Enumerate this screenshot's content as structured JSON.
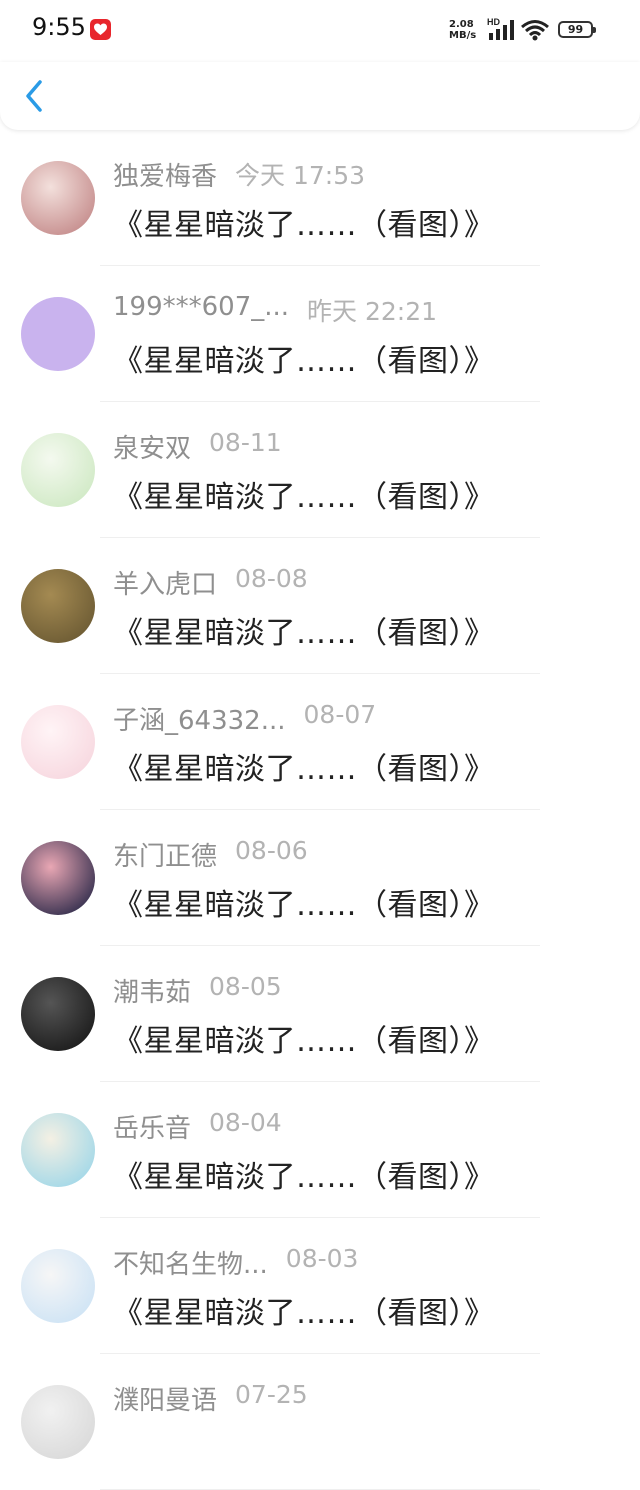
{
  "status_bar": {
    "time": "9:55",
    "net_speed_value": "2.08",
    "net_speed_unit": "MB/s",
    "network_type": "HD",
    "battery": "99"
  },
  "nav": {
    "back_icon": "chevron-left-icon",
    "accent_color": "#2a9be6"
  },
  "messages": [
    {
      "user": "独爱梅香",
      "time": "今天 17:53",
      "title": "《星星暗淡了……（看图）》",
      "avatar_colors": [
        "#c48a8a",
        "#f3e0dc"
      ]
    },
    {
      "user": "199***607_...",
      "time": "昨天 22:21",
      "title": "《星星暗淡了……（看图）》",
      "avatar_colors": [
        "#c9b3ee",
        "#c9b3ee"
      ]
    },
    {
      "user": "泉安双",
      "time": "08-11",
      "title": "《星星暗淡了……（看图）》",
      "avatar_colors": [
        "#cfe9c4",
        "#f4f9ef"
      ]
    },
    {
      "user": "羊入虎口",
      "time": "08-08",
      "title": "《星星暗淡了……（看图）》",
      "avatar_colors": [
        "#6b5a33",
        "#a48a52"
      ]
    },
    {
      "user": "子涵_64332...",
      "time": "08-07",
      "title": "《星星暗淡了……（看图）》",
      "avatar_colors": [
        "#f7d7df",
        "#fff4f6"
      ]
    },
    {
      "user": "东门正德",
      "time": "08-06",
      "title": "《星星暗淡了……（看图）》",
      "avatar_colors": [
        "#2d2a4a",
        "#e9a7b4"
      ]
    },
    {
      "user": "潮韦茹",
      "time": "08-05",
      "title": "《星星暗淡了……（看图）》",
      "avatar_colors": [
        "#1a1a1a",
        "#555555"
      ]
    },
    {
      "user": "岳乐音",
      "time": "08-04",
      "title": "《星星暗淡了……（看图）》",
      "avatar_colors": [
        "#9fd7e8",
        "#f4f0e4"
      ]
    },
    {
      "user": "不知名生物...",
      "time": "08-03",
      "title": "《星星暗淡了……（看图）》",
      "avatar_colors": [
        "#cde3f5",
        "#f6f6f6"
      ]
    },
    {
      "user": "濮阳曼语",
      "time": "07-25",
      "title": "",
      "avatar_colors": [
        "#d9d9d9",
        "#f1f1f1"
      ]
    }
  ]
}
